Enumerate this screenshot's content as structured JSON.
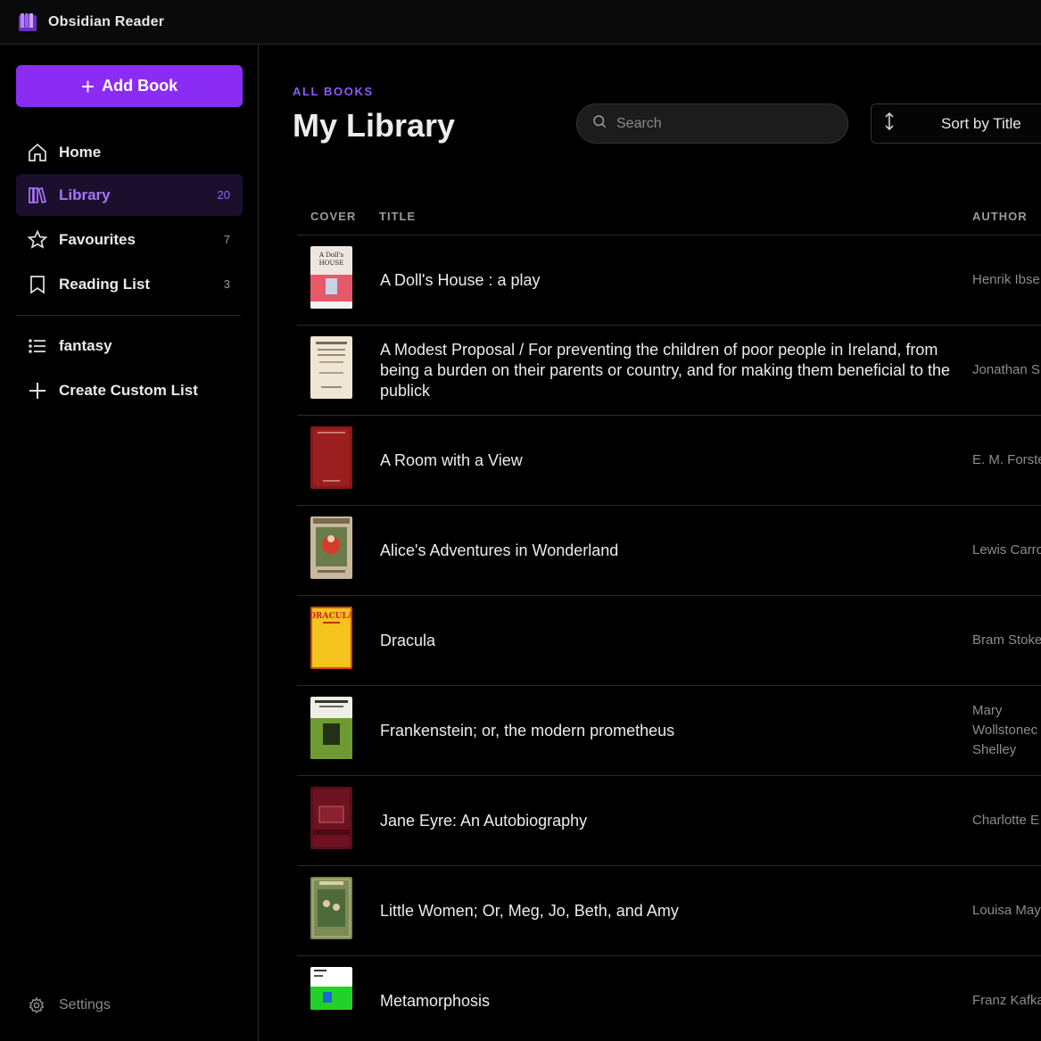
{
  "app": {
    "title": "Obsidian Reader",
    "accent": "#8b2cf5"
  },
  "sidebar": {
    "add_book_label": "Add Book",
    "nav": [
      {
        "label": "Home",
        "icon": "home-icon",
        "count": ""
      },
      {
        "label": "Library",
        "icon": "library-icon",
        "count": "20"
      },
      {
        "label": "Favourites",
        "icon": "star-icon",
        "count": "7"
      },
      {
        "label": "Reading List",
        "icon": "bookmark-icon",
        "count": "3"
      }
    ],
    "lists": [
      {
        "label": "fantasy",
        "icon": "list-icon"
      },
      {
        "label": "Create Custom List",
        "icon": "plus-icon"
      }
    ],
    "settings_label": "Settings"
  },
  "main": {
    "eyebrow": "ALL BOOKS",
    "title": "My Library",
    "search_placeholder": "Search",
    "sort_label": "Sort by Title",
    "columns": {
      "cover": "COVER",
      "title": "TITLE",
      "author": "AUTHOR"
    },
    "books": [
      {
        "title": "A Doll's House : a play",
        "author": "Henrik Ibse",
        "cover_color": "#e8e0d8"
      },
      {
        "title": "A Modest Proposal / For preventing the children of poor people in Ireland, from being a burden on their parents or country, and for making them beneficial to the publick",
        "author": "Jonathan S",
        "cover_color": "#efe6d6"
      },
      {
        "title": "A Room with a View",
        "author": "E. M. Forste",
        "cover_color": "#8e1a1a"
      },
      {
        "title": "Alice's Adventures in Wonderland",
        "author": "Lewis Carro",
        "cover_color": "#c9b9a0"
      },
      {
        "title": "Dracula",
        "author": "Bram Stoke",
        "cover_color": "#f2c41c"
      },
      {
        "title": "Frankenstein; or, the modern prometheus",
        "author": "Mary Wollstonec Shelley",
        "cover_color": "#7a9a3a"
      },
      {
        "title": "Jane Eyre: An Autobiography",
        "author": "Charlotte E",
        "cover_color": "#6e1020"
      },
      {
        "title": "Little Women; Or, Meg, Jo, Beth, and Amy",
        "author": "Louisa May",
        "cover_color": "#7c8a55"
      },
      {
        "title": "Metamorphosis",
        "author": "Franz Kafka",
        "cover_color": "#22d22a"
      }
    ]
  }
}
